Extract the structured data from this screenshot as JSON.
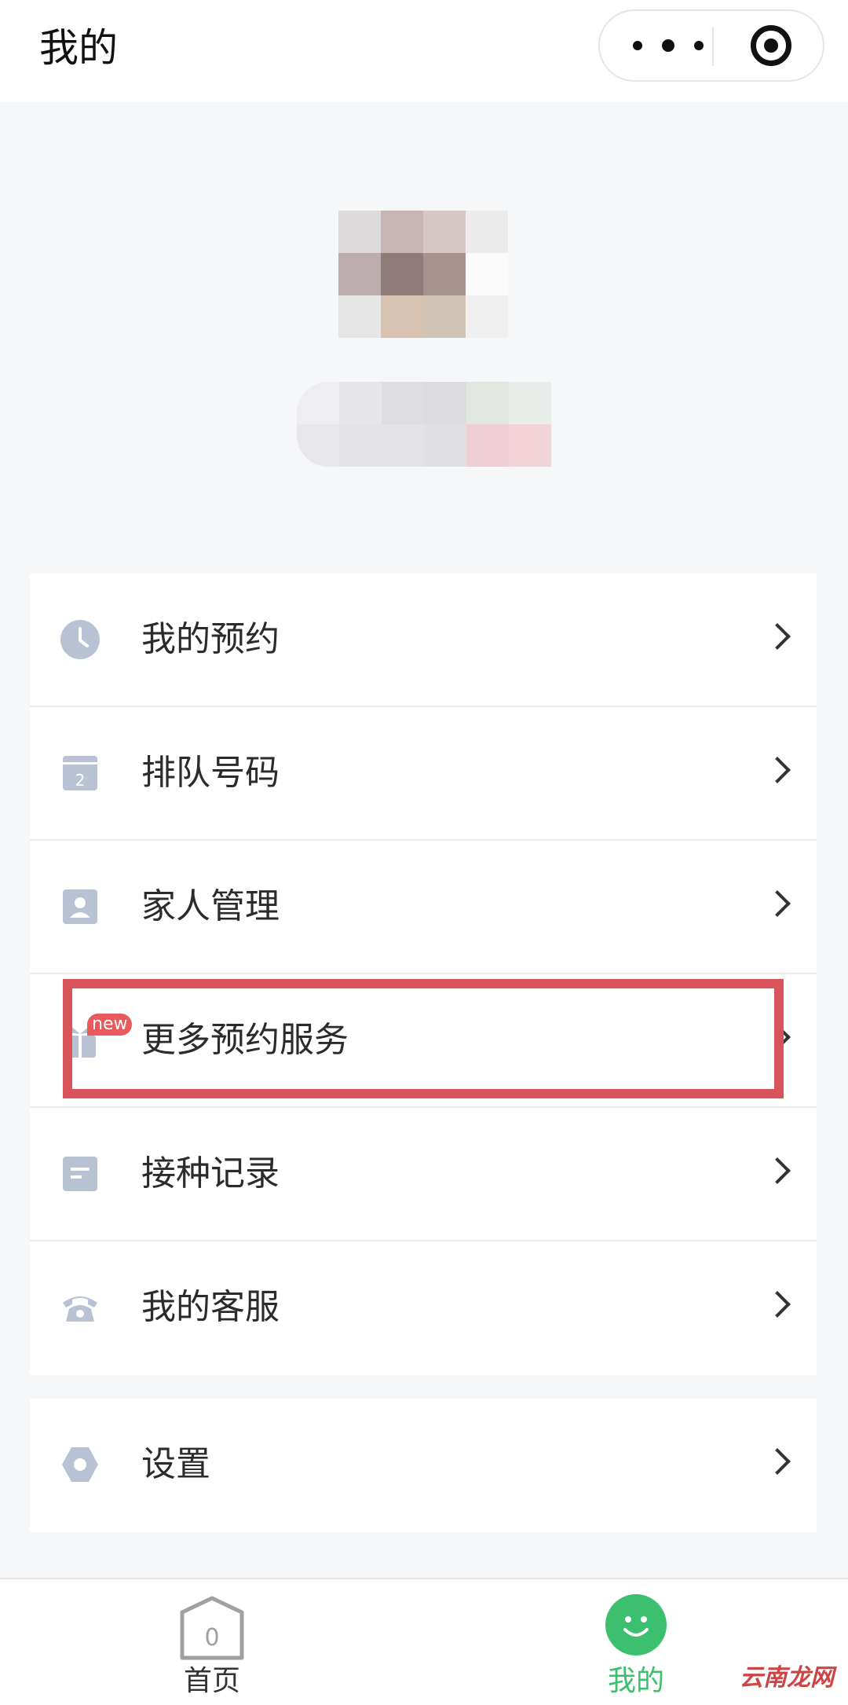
{
  "header": {
    "title": "我的",
    "more_icon": "more-dots-icon",
    "close_icon": "target-icon"
  },
  "menu": [
    {
      "label": "我的预约",
      "icon": "clock-icon"
    },
    {
      "label": "排队号码",
      "icon": "queue-ticket-icon",
      "icon_text": "2"
    },
    {
      "label": "家人管理",
      "icon": "contact-card-icon"
    },
    {
      "label": "更多预约服务",
      "icon": "gift-icon",
      "badge": "new",
      "highlighted": true
    },
    {
      "label": "接种记录",
      "icon": "record-icon"
    },
    {
      "label": "我的客服",
      "icon": "telephone-icon"
    }
  ],
  "settings": {
    "label": "设置",
    "icon": "hexagon-settings-icon"
  },
  "tabbar": {
    "home": {
      "label": "首页",
      "icon": "home-hexagon-icon",
      "icon_text": "0"
    },
    "mine": {
      "label": "我的",
      "icon": "smile-face-icon",
      "active": true
    }
  },
  "watermark": "云南龙网",
  "colors": {
    "icon_gray": "#b9c2d2",
    "active_green": "#3cbf6e",
    "highlight_red": "#d9535a",
    "badge_red": "#e95a5a"
  }
}
